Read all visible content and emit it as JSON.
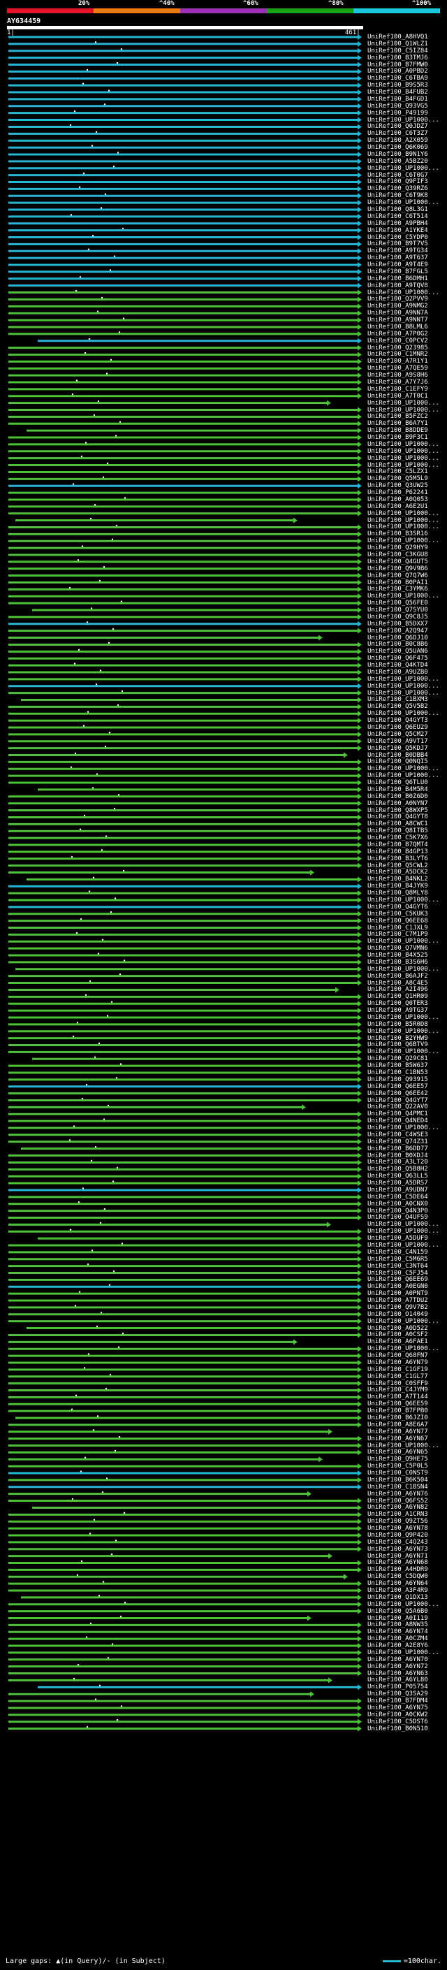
{
  "header": {
    "scale_labels": [
      "20%",
      "^40%",
      "^60%",
      "^80%",
      "^100%"
    ],
    "query_name": "AY634459",
    "query_start": "1|",
    "query_end": "461|"
  },
  "colors": {
    "scale": [
      "#e8142b",
      "#f07a10",
      "#9b2fb5",
      "#17a317",
      "#19c7dd"
    ],
    "identity_100": "#29b6d6",
    "identity_80": "#4ec23a",
    "background": "#000000",
    "query_bar": "#ffffff"
  },
  "hits": [
    "UniRef100_A8HVQ1",
    "UniRef100_Q1WLZ1",
    "UniRef100_C5IZ84",
    "UniRef100_B3TMJ6",
    "UniRef100_B7FMW0",
    "UniRef100_A0PBD2",
    "UniRef100_C6TBA9",
    "UniRef100_B9S5R3",
    "UniRef100_B4FUB2",
    "UniRef100_B4FGD1",
    "UniRef100_Q93VG5",
    "UniRef100_P49199",
    "UniRef100_UP1000...",
    "UniRef100_Q0JDZ7",
    "UniRef100_C6T3Z7",
    "UniRef100_A2X059",
    "UniRef100_Q6K069",
    "UniRef100_B9N1Y6",
    "UniRef100_A5BZ20",
    "UniRef100_UP1000...",
    "UniRef100_C6T0G7",
    "UniRef100_Q9FIF3",
    "UniRef100_Q39RZ6",
    "UniRef100_C6T9K8",
    "UniRef100_UP1000...",
    "UniRef100_Q8L3G1",
    "UniRef100_C6T514",
    "UniRef100_A9PBH4",
    "UniRef100_A1YKE4",
    "UniRef100_C5YDP0",
    "UniRef100_B9T7V5",
    "UniRef100_A9TG34",
    "UniRef100_A9T637",
    "UniRef100_A9T4E9",
    "UniRef100_B7FGL5",
    "UniRef100_B6DMH1",
    "UniRef100_A9TQV8",
    "UniRef100_UP1000...",
    "UniRef100_Q2PVV9",
    "UniRef100_A9NMG2",
    "UniRef100_A9NN7A",
    "UniRef100_A9NNT7",
    "UniRef100_B8LML6",
    "UniRef100_A7P0G2",
    "UniRef100_C0PCV2",
    "UniRef100_Q23985",
    "UniRef100_C1MNR2",
    "UniRef100_A7R1Y1",
    "UniRef100_A7QE59",
    "UniRef100_A9S8H6",
    "UniRef100_A7Y7J6",
    "UniRef100_C1EFY9",
    "UniRef100_A7T0C1",
    "UniRef100_UP1000...",
    "UniRef100_UP1000...",
    "UniRef100_B5FZC2",
    "UniRef100_B6A7Y1",
    "UniRef100_B8DDE9",
    "UniRef100_B9F3C1",
    "UniRef100_UP1000...",
    "UniRef100_UP1000...",
    "UniRef100_UP1000...",
    "UniRef100_UP1000...",
    "UniRef100_C5LZX1",
    "UniRef100_Q5M5L9",
    "UniRef100_Q3UW25",
    "UniRef100_P62241",
    "UniRef100_A0Q053",
    "UniRef100_A6E2U1",
    "UniRef100_UP1000...",
    "UniRef100_UP1000...",
    "UniRef100_UP1000...",
    "UniRef100_B3SR16",
    "UniRef100_UP1000...",
    "UniRef100_Q29HY9",
    "UniRef100_C3KGU8",
    "UniRef100_Q4GUT5",
    "UniRef100_Q9V9B6",
    "UniRef100_Q7Q7W6",
    "UniRef100_B0PAI1",
    "UniRef100_C3YMK6",
    "UniRef100_UP1000...",
    "UniRef100_Q56FE0",
    "UniRef100_Q7SYU0",
    "UniRef100_Q9C8J5",
    "UniRef100_B5DXX7",
    "UniRef100_A2Q947",
    "UniRef100_Q6DJ10",
    "UniRef100_B0C8B6",
    "UniRef100_Q5UAN6",
    "UniRef100_Q6F475",
    "UniRef100_Q4KTD4",
    "UniRef100_A9UZB0",
    "UniRef100_UP1000...",
    "UniRef100_UP1000...",
    "UniRef100_UP1000...",
    "UniRef100_C1BXM3",
    "UniRef100_Q5V5B2",
    "UniRef100_UP1000...",
    "UniRef100_Q4GYT3",
    "UniRef100_Q6EU29",
    "UniRef100_Q5CM27",
    "UniRef100_A9VT17",
    "UniRef100_Q5KDJ7",
    "UniRef100_B0DBB4",
    "UniRef100_Q0NQI5",
    "UniRef100_UP1000...",
    "UniRef100_UP1000...",
    "UniRef100_Q6TLU0",
    "UniRef100_B4M5R4",
    "UniRef100_B0Z6D0",
    "UniRef100_A0NYN7",
    "UniRef100_Q8WXP5",
    "UniRef100_Q4GYT8",
    "UniRef100_A8CWC1",
    "UniRef100_Q8ITB5",
    "UniRef100_C5K7X6",
    "UniRef100_B7QMT4",
    "UniRef100_B4GP13",
    "UniRef100_B3LYT6",
    "UniRef100_Q5CWL2",
    "UniRef100_A5DCK2",
    "UniRef100_B4NKL2",
    "UniRef100_B4JYK9",
    "UniRef100_Q8MLY8",
    "UniRef100_UP1000...",
    "UniRef100_Q4GYT6",
    "UniRef100_C5KUK3",
    "UniRef100_Q6EE68",
    "UniRef100_C1JXL9",
    "UniRef100_C7M1P9",
    "UniRef100_UP1000...",
    "UniRef100_Q7VMN6",
    "UniRef100_B4X525",
    "UniRef100_B3S6H6",
    "UniRef100_UP1000...",
    "UniRef100_B6AJF2",
    "UniRef100_A8C4E5",
    "UniRef100_A2I496",
    "UniRef100_Q1HR09",
    "UniRef100_Q0TER3",
    "UniRef100_A9TG37",
    "UniRef100_UP1000...",
    "UniRef100_B5R0D8",
    "UniRef100_UP1000...",
    "UniRef100_B2YHW9",
    "UniRef100_Q6BTV9",
    "UniRef100_UP1000...",
    "UniRef100_Q29C81",
    "UniRef100_B5W637",
    "UniRef100_C1BN53",
    "UniRef100_Q93915",
    "UniRef100_Q6EE57",
    "UniRef100_Q6EE42",
    "UniRef100_Q4GYT7",
    "UniRef100_Q22AV0",
    "UniRef100_Q4PMC1",
    "UniRef100_Q4NED4",
    "UniRef100_UP1000...",
    "UniRef100_C4WSE3",
    "UniRef100_Q74Z31",
    "UniRef100_B6DD77",
    "UniRef100_B0XDJ4",
    "UniRef100_A3LT20",
    "UniRef100_Q5B8H2",
    "UniRef100_Q63LL5",
    "UniRef100_A5DRS7",
    "UniRef100_A9UDN7",
    "UniRef100_C5DE64",
    "UniRef100_A0CNX0",
    "UniRef100_Q4N3P0",
    "UniRef100_Q4UFS9",
    "UniRef100_UP1000...",
    "UniRef100_UP1000...",
    "UniRef100_A5DUF9",
    "UniRef100_UP1000...",
    "UniRef100_C4N159",
    "UniRef100_C5M6R5",
    "UniRef100_C3NT64",
    "UniRef100_C5FJ54",
    "UniRef100_Q6EE69",
    "UniRef100_A0EGN0",
    "UniRef100_A0PNT9",
    "UniRef100_A7TDU2",
    "UniRef100_Q9V7B2",
    "UniRef100_O14049",
    "UniRef100_UP1000...",
    "UniRef100_A0D522",
    "UniRef100_A0CSF2",
    "UniRef100_A6FAE1",
    "UniRef100_UP1000...",
    "UniRef100_Q68FN7",
    "UniRef100_A6YN79",
    "UniRef100_C1GF19",
    "UniRef100_C1GL77",
    "UniRef100_C0SFF9",
    "UniRef100_C4JYM9",
    "UniRef100_A7T144",
    "UniRef100_Q6EE59",
    "UniRef100_B7FPB0",
    "UniRef100_B6JZI0",
    "UniRef100_A8E6A7",
    "UniRef100_A6YN77",
    "UniRef100_A6YN67",
    "UniRef100_UP1000...",
    "UniRef100_A6YN65",
    "UniRef100_Q9HE75",
    "UniRef100_C5P0L5",
    "UniRef100_C0NST9",
    "UniRef100_B6K504",
    "UniRef100_C1BSN4",
    "UniRef100_A6YN76",
    "UniRef100_Q6FS52",
    "UniRef100_A6YN82",
    "UniRef100_A1CRN3",
    "UniRef100_Q9ZT56",
    "UniRef100_A6YN78",
    "UniRef100_Q9P420",
    "UniRef100_C4Q243",
    "UniRef100_A6YN73",
    "UniRef100_A6YN71",
    "UniRef100_A6YN68",
    "UniRef100_A4HDR9",
    "UniRef100_C5DQW0",
    "UniRef100_A6YN64",
    "UniRef100_A3F4R9",
    "UniRef100_Q1DX13",
    "UniRef100_UP1000...",
    "UniRef100_Q5A6B0",
    "UniRef100_A0I119",
    "UniRef100_A8NW35",
    "UniRef100_A6YN74",
    "UniRef100_A0CZM4",
    "UniRef100_A2E8Y6",
    "UniRef100_UP1000...",
    "UniRef100_A6YN70",
    "UniRef100_A6YN72",
    "UniRef100_A6YN63",
    "UniRef100_A6YL80",
    "UniRef100_P05754",
    "UniRef100_Q3SA29",
    "UniRef100_B7FDM4",
    "UniRef100_A6YN75",
    "UniRef100_A0CKW2",
    "UniRef100_C5DST6",
    "UniRef100_B0N510"
  ],
  "footer": {
    "gap_legend": "Large gaps: ▲(in Query)/- (in Subject)",
    "char_legend": "=100char."
  }
}
